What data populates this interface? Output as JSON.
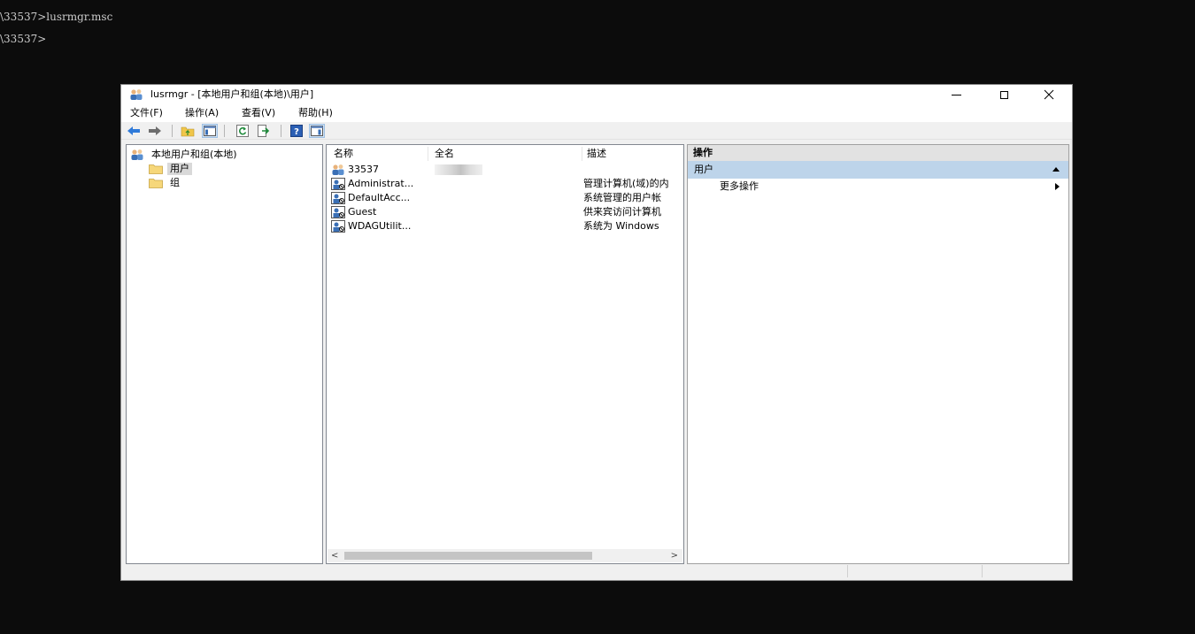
{
  "console": {
    "lines": [
      "\\33537>lusrmgr.msc",
      "\\33537>"
    ]
  },
  "window": {
    "title": "lusrmgr - [本地用户和组(本地)\\用户]",
    "controls": {
      "minimize": "—",
      "maximize": "□",
      "close": "✕"
    }
  },
  "menu": [
    "文件(F)",
    "操作(A)",
    "查看(V)",
    "帮助(H)"
  ],
  "toolbar": {
    "icons": [
      "back-icon",
      "forward-icon",
      "up-folder-icon",
      "show-hide-console-tree-icon",
      "refresh-icon",
      "export-list-icon",
      "help-icon",
      "show-hide-action-pane-icon"
    ]
  },
  "tree": {
    "root": "本地用户和组(本地)",
    "users": "用户",
    "groups": "组"
  },
  "list": {
    "columns": {
      "name": "名称",
      "full_name": "全名",
      "description": "描述"
    },
    "rows": [
      {
        "name": "33537",
        "full_name": "",
        "description": ""
      },
      {
        "name": "Administrat...",
        "full_name": "",
        "description": "管理计算机(域)的内"
      },
      {
        "name": "DefaultAcc...",
        "full_name": "",
        "description": "系统管理的用户帐"
      },
      {
        "name": "Guest",
        "full_name": "",
        "description": "供来宾访问计算机"
      },
      {
        "name": "WDAGUtilit...",
        "full_name": "",
        "description": "系统为 Windows"
      }
    ],
    "scroll_left": "<",
    "scroll_right": ">"
  },
  "actions": {
    "header": "操作",
    "section": "用户",
    "more": "更多操作"
  },
  "colors": {
    "console_bg": "#0c0c0c",
    "console_text": "#cccccc",
    "action_section_bg": "#bdd4ea",
    "tree_selection": "#d9d9d9"
  }
}
